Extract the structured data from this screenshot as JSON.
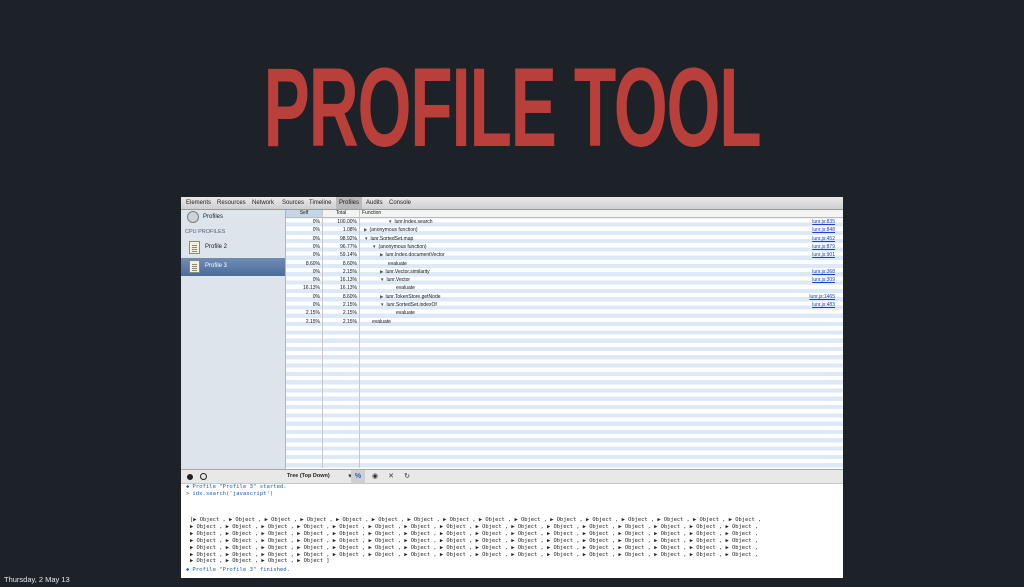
{
  "slide": {
    "title": "PROFILE TOOL",
    "date": "Thursday, 2 May 13"
  },
  "devtools": {
    "tabs": [
      "Elements",
      "Resources",
      "Network",
      "Sources",
      "Timeline",
      "Profiles",
      "Audits",
      "Console"
    ],
    "active_tab": "Profiles",
    "sidebar": {
      "root_label": "Profiles",
      "section_header": "CPU PROFILES",
      "profiles": [
        {
          "label": "Profile 2",
          "selected": false
        },
        {
          "label": "Profile 3",
          "selected": true
        }
      ]
    },
    "grid": {
      "headers": {
        "self": "Self",
        "total": "Total",
        "function": "Function"
      },
      "rows": [
        {
          "self": "0%",
          "total": "100.00%",
          "depth": 3,
          "toggle": "open",
          "func": "lunr.Index.search",
          "link": "lunr.js:835"
        },
        {
          "self": "0%",
          "total": "1.08%",
          "depth": 0,
          "toggle": "closed",
          "func": "(anonymous function)",
          "link": "lunr.js:848"
        },
        {
          "self": "0%",
          "total": "98.92%",
          "depth": 0,
          "toggle": "open",
          "func": "lunr.SortedSet.map",
          "link": "lunr.js:452"
        },
        {
          "self": "0%",
          "total": "96.77%",
          "depth": 1,
          "toggle": "open",
          "func": "(anonymous function)",
          "link": "lunr.js:879"
        },
        {
          "self": "0%",
          "total": "59.14%",
          "depth": 2,
          "toggle": "closed",
          "func": "lunr.Index.documentVector",
          "link": "lunr.js:901"
        },
        {
          "self": "8.60%",
          "total": "8.60%",
          "depth": 3,
          "toggle": "",
          "func": "evaluate",
          "link": ""
        },
        {
          "self": "0%",
          "total": "2.15%",
          "depth": 2,
          "toggle": "closed",
          "func": "lunr.Vector.similarity",
          "link": "lunr.js:368"
        },
        {
          "self": "0%",
          "total": "16.13%",
          "depth": 2,
          "toggle": "open",
          "func": "lunr.Vector",
          "link": "lunr.js:309"
        },
        {
          "self": "16.13%",
          "total": "16.13%",
          "depth": 4,
          "toggle": "",
          "func": "evaluate",
          "link": ""
        },
        {
          "self": "0%",
          "total": "8.60%",
          "depth": 2,
          "toggle": "closed",
          "func": "lunr.TokenStore.getNode",
          "link": "lunr.js:1465"
        },
        {
          "self": "0%",
          "total": "2.15%",
          "depth": 2,
          "toggle": "open",
          "func": "lunr.SortedSet.indexOf",
          "link": "lunr.js:483"
        },
        {
          "self": "2.15%",
          "total": "2.15%",
          "depth": 4,
          "toggle": "",
          "func": "evaluate",
          "link": ""
        },
        {
          "self": "2.15%",
          "total": "2.15%",
          "depth": 1,
          "toggle": "",
          "func": "evaluate",
          "link": ""
        }
      ]
    },
    "statusbar": {
      "view_select": "Tree (Top Down)",
      "icons": [
        "record-icon",
        "clear-icon",
        "percent-icon",
        "eye-icon",
        "close-icon",
        "refresh-icon"
      ],
      "percent_label": "%",
      "eye_label": "◉",
      "x_label": "✕",
      "refresh_label": "↻"
    },
    "console": {
      "line1_prefix": "◆",
      "line1": "Profile \"Profile 3\" started.",
      "line2_prefix": ">",
      "line2": "idx.search('javascript')",
      "object_rows": [
        "[▶ Object , ▶ Object , ▶ Object , ▶ Object , ▶ Object , ▶ Object , ▶ Object , ▶ Object , ▶ Object , ▶ Object , ▶ Object , ▶ Object , ▶ Object , ▶ Object , ▶ Object , ▶ Object ,",
        " ▶ Object , ▶ Object , ▶ Object , ▶ Object , ▶ Object , ▶ Object , ▶ Object , ▶ Object , ▶ Object , ▶ Object , ▶ Object , ▶ Object , ▶ Object , ▶ Object , ▶ Object , ▶ Object ,",
        " ▶ Object , ▶ Object , ▶ Object , ▶ Object , ▶ Object , ▶ Object , ▶ Object , ▶ Object , ▶ Object , ▶ Object , ▶ Object , ▶ Object , ▶ Object , ▶ Object , ▶ Object , ▶ Object ,",
        " ▶ Object , ▶ Object , ▶ Object , ▶ Object , ▶ Object , ▶ Object , ▶ Object , ▶ Object , ▶ Object , ▶ Object , ▶ Object , ▶ Object , ▶ Object , ▶ Object , ▶ Object , ▶ Object ,",
        " ▶ Object , ▶ Object , ▶ Object , ▶ Object , ▶ Object , ▶ Object , ▶ Object , ▶ Object , ▶ Object , ▶ Object , ▶ Object , ▶ Object , ▶ Object , ▶ Object , ▶ Object , ▶ Object ,",
        " ▶ Object , ▶ Object , ▶ Object , ▶ Object , ▶ Object , ▶ Object , ▶ Object , ▶ Object , ▶ Object , ▶ Object , ▶ Object , ▶ Object , ▶ Object , ▶ Object , ▶ Object , ▶ Object ,",
        " ▶ Object , ▶ Object , ▶ Object , ▶ Object ]"
      ],
      "last_prefix": "◆",
      "last_line": "Profile \"Profile 3\" finished."
    }
  }
}
